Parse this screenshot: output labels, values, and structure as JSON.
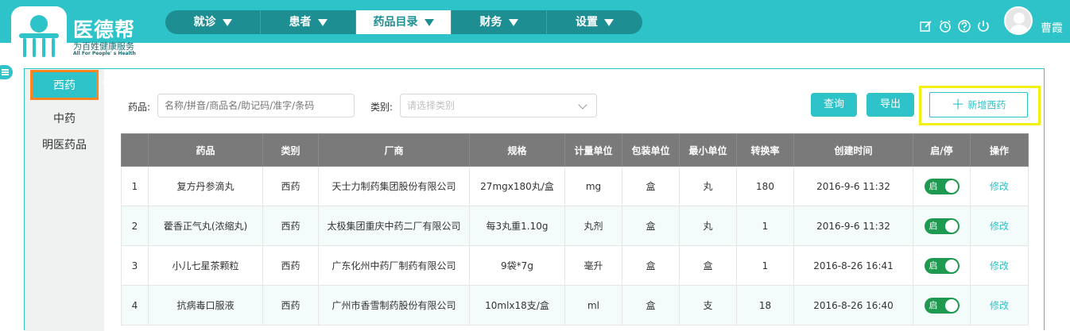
{
  "brand": {
    "name": "医德帮",
    "tagline_cn": "为百姓健康服务",
    "tagline_en": "All For People' s Health"
  },
  "nav": {
    "items": [
      {
        "label": "就诊"
      },
      {
        "label": "患者"
      },
      {
        "label": "药品目录"
      },
      {
        "label": "财务"
      },
      {
        "label": "设置"
      }
    ],
    "active_index": 2
  },
  "header": {
    "icons": [
      "edit-icon",
      "alarm-icon",
      "help-icon",
      "power-icon"
    ],
    "username": "曹霞"
  },
  "sidebar": {
    "items": [
      {
        "label": "西药"
      },
      {
        "label": "中药"
      },
      {
        "label": "明医药品"
      }
    ],
    "active_index": 0
  },
  "filters": {
    "drug_label": "药品:",
    "drug_placeholder": "名称/拼音/商品名/助记码/准字/条码",
    "category_label": "类别:",
    "category_placeholder": "请选择类别"
  },
  "actions": {
    "query": "查询",
    "export": "导出",
    "add": "新增西药"
  },
  "table": {
    "headers": [
      "",
      "药品",
      "类别",
      "厂商",
      "规格",
      "计量单位",
      "包装单位",
      "最小单位",
      "转换率",
      "创建时间",
      "启/停",
      "操作"
    ],
    "rows": [
      {
        "no": "1",
        "name": "复方丹参滴丸",
        "category": "西药",
        "maker": "天士力制药集团股份有限公司",
        "spec": "27mgx180丸/盒",
        "unit": "mg",
        "pack": "盒",
        "min": "丸",
        "rate": "180",
        "created": "2016-9-6 11:32",
        "status": "启",
        "action": "修改"
      },
      {
        "no": "2",
        "name": "藿香正气丸(浓缩丸)",
        "category": "西药",
        "maker": "太极集团重庆中药二厂有限公司",
        "spec": "每3丸重1.10g",
        "unit": "丸剂",
        "pack": "盒",
        "min": "丸",
        "rate": "1",
        "created": "2016-9-6 11:32",
        "status": "启",
        "action": "修改"
      },
      {
        "no": "3",
        "name": "小儿七星茶颗粒",
        "category": "西药",
        "maker": "广东化州中药厂制药有限公司",
        "spec": "9袋*7g",
        "unit": "毫升",
        "pack": "盒",
        "min": "盒",
        "rate": "1",
        "created": "2016-8-26 16:41",
        "status": "启",
        "action": "修改"
      },
      {
        "no": "4",
        "name": "抗病毒口服液",
        "category": "西药",
        "maker": "广州市香雪制药股份有限公司",
        "spec": "10mlx18支/盒",
        "unit": "ml",
        "pack": "盒",
        "min": "支",
        "rate": "18",
        "created": "2016-8-26 16:40",
        "status": "启",
        "action": "修改"
      }
    ]
  },
  "colors": {
    "accent": "#2ec3c8",
    "nav_bg": "#1d8e92",
    "table_header": "#7a7a7a",
    "toggle_on": "#1e9950",
    "selected_outline": "#ff8522",
    "highlight_outline": "#f2ef14"
  }
}
